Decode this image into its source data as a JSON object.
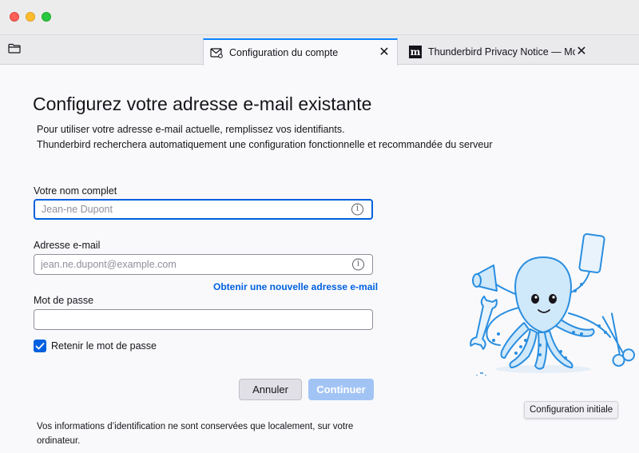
{
  "window": {
    "controls": [
      "close",
      "minimize",
      "maximize"
    ]
  },
  "tabs": [
    {
      "label": "Configuration du compte",
      "icon": "mail-settings-icon",
      "active": true
    },
    {
      "label": "Thunderbird Privacy Notice — Mozilla",
      "icon": "mozilla-icon",
      "active": false
    }
  ],
  "page": {
    "heading": "Configurez votre adresse e-mail existante",
    "description_line1": "Pour utiliser votre adresse e-mail actuelle, remplissez vos identifiants.",
    "description_line2": "Thunderbird recherchera automatiquement une configuration fonctionnelle et recommandée du serveur"
  },
  "form": {
    "name_label": "Votre nom complet",
    "name_placeholder": "Jean-ne Dupont",
    "email_label": "Adresse e-mail",
    "email_placeholder": "jean.ne.dupont@example.com",
    "new_address_link": "Obtenir une nouvelle adresse e-mail",
    "password_label": "Mot de passe",
    "password_value": "",
    "remember_label": "Retenir le mot de passe",
    "remember_checked": true
  },
  "buttons": {
    "cancel": "Annuler",
    "continue": "Continuer"
  },
  "footnote": "Vos informations d’identification ne sont conservées que localement, sur votre ordinateur.",
  "tooltip": "Configuration initiale",
  "colors": {
    "accent": "#0060df",
    "tab_indicator": "#0a84ff",
    "continue_disabled": "#a2c4f5",
    "mascot_fill": "#cfe8fa",
    "mascot_stroke": "#2a8ee0"
  }
}
